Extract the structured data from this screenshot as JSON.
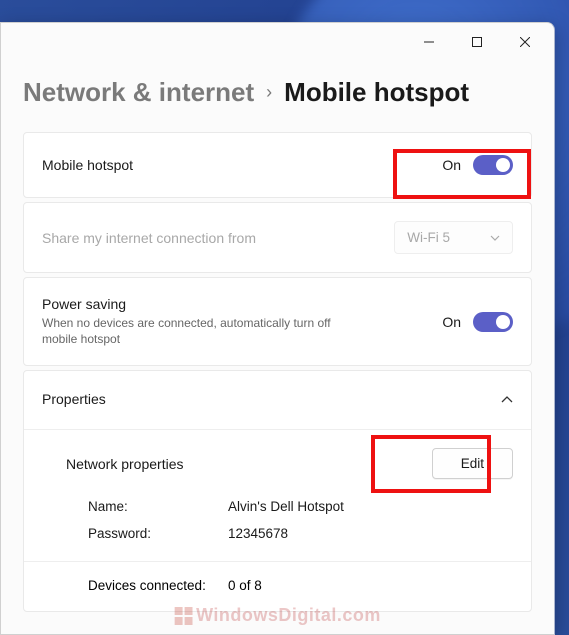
{
  "breadcrumb": {
    "parent": "Network & internet",
    "separator": "›",
    "current": "Mobile hotspot"
  },
  "hotspot_toggle": {
    "label": "Mobile hotspot",
    "state_text": "On",
    "on": true
  },
  "share_from": {
    "label": "Share my internet connection from",
    "value": "Wi-Fi 5"
  },
  "power_saving": {
    "label": "Power saving",
    "description": "When no devices are connected, automatically turn off mobile hotspot",
    "state_text": "On",
    "on": true
  },
  "properties": {
    "header": "Properties",
    "network_props_label": "Network properties",
    "edit_label": "Edit",
    "name_label": "Name:",
    "name_value": "Alvin's Dell Hotspot",
    "password_label": "Password:",
    "password_value": "12345678",
    "devices_label": "Devices connected:",
    "devices_value": "0 of 8"
  },
  "watermark": "WindowsDigital.com",
  "colors": {
    "accent": "#5b5fc7",
    "highlight": "#e11"
  }
}
